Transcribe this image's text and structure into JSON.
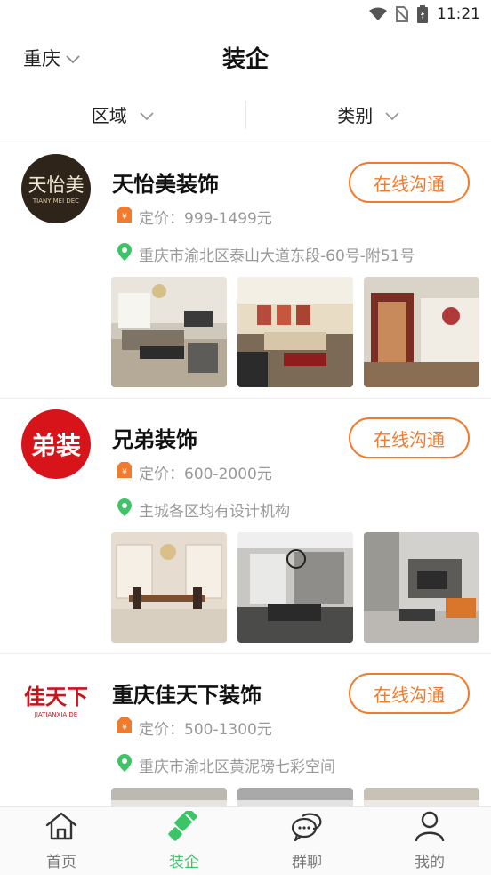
{
  "status_bar": {
    "time": "11:21"
  },
  "header": {
    "city": "重庆",
    "title": "装企"
  },
  "filters": [
    {
      "label": "区域"
    },
    {
      "label": "类别"
    }
  ],
  "companies": [
    {
      "name": "天怡美装饰",
      "logo_text": "天怡美",
      "logo_sub": "TIANYIMEI DEC",
      "price": "定价：999-1499元",
      "address": "重庆市渝北区泰山大道东段-60号-附51号",
      "button": "在线沟通"
    },
    {
      "name": "兄弟装饰",
      "logo_text": "弟装",
      "price": "定价：600-2000元",
      "address": "主城各区均有设计机构",
      "button": "在线沟通"
    },
    {
      "name": "重庆佳天下装饰",
      "logo_text": "佳天下",
      "logo_sub": "JIATIANXIA DE",
      "price": "定价：500-1300元",
      "address": "重庆市渝北区黄泥磅七彩空间",
      "button": "在线沟通"
    }
  ],
  "tabs": [
    {
      "label": "首页",
      "icon": "home-icon"
    },
    {
      "label": "装企",
      "icon": "brush-icon",
      "active": true
    },
    {
      "label": "群聊",
      "icon": "chat-bubbles-icon"
    },
    {
      "label": "我的",
      "icon": "person-icon"
    }
  ],
  "colors": {
    "accent": "#f07b2d",
    "tab_active": "#3cc467",
    "location_pin": "#3cc467"
  }
}
